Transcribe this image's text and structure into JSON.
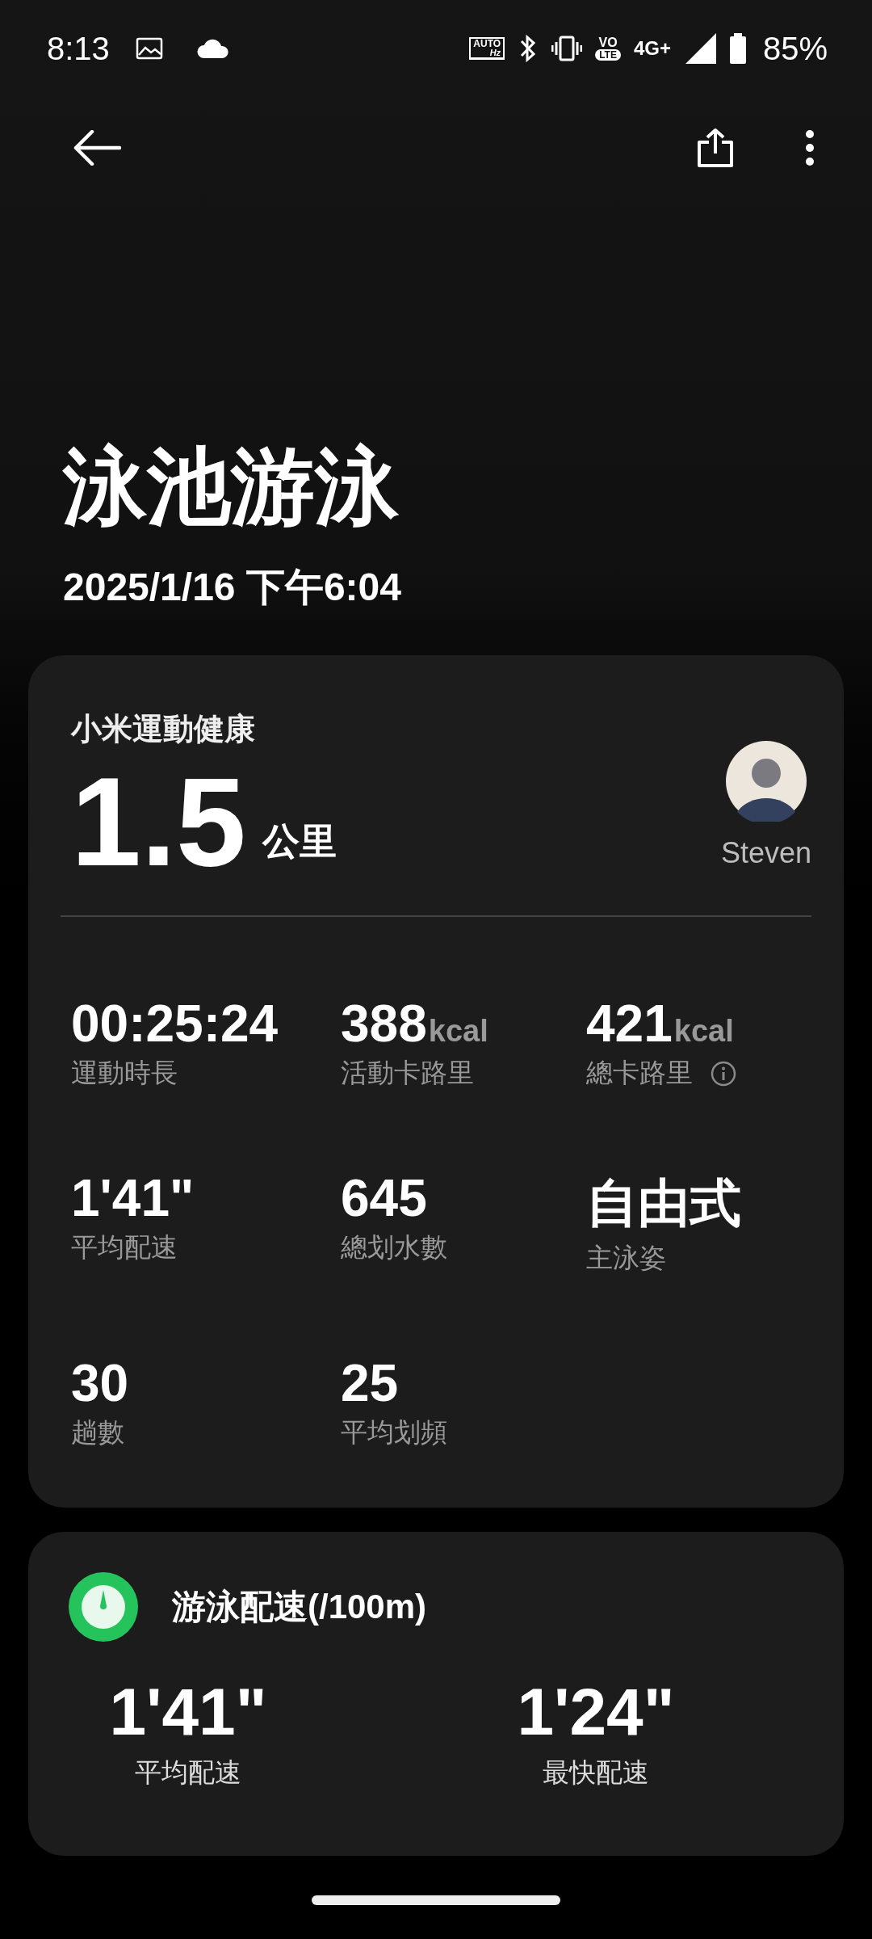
{
  "status_bar": {
    "time": "8:13",
    "icons": [
      {
        "kind": "refresh",
        "label": "AUTO",
        "sub": "Hz"
      },
      {
        "kind": "bluetooth"
      },
      {
        "kind": "vibrate"
      },
      {
        "kind": "volte",
        "label": "VO",
        "sub": "LTE"
      },
      {
        "kind": "network",
        "label": "4G+"
      },
      {
        "kind": "signal"
      },
      {
        "kind": "battery"
      }
    ],
    "battery": "85%"
  },
  "title": "泳池游泳",
  "datetime": "2025/1/16 下午6:04",
  "summary": {
    "source": "小米運動健康",
    "distance": "1.5",
    "unit": "公里",
    "user": "Steven",
    "stats": [
      {
        "value": "00:25:24",
        "label": "運動時長",
        "info": false
      },
      {
        "value": "388",
        "unit": "kcal",
        "label": "活動卡路里",
        "info": false
      },
      {
        "value": "421",
        "unit": "kcal",
        "label": "總卡路里",
        "info": true
      },
      {
        "value": "1'41\"",
        "label": "平均配速",
        "info": false
      },
      {
        "value": "645",
        "label": "總划水數",
        "info": false
      },
      {
        "value": "自由式",
        "label": "主泳姿",
        "info": false
      },
      {
        "value": "30",
        "label": "趟數",
        "info": false
      },
      {
        "value": "25",
        "label": "平均划頻",
        "info": false
      }
    ]
  },
  "pace": {
    "title": "游泳配速(/100m)",
    "items": [
      {
        "value": "1'41\"",
        "label": "平均配速"
      },
      {
        "value": "1'24\"",
        "label": "最快配速"
      }
    ]
  }
}
